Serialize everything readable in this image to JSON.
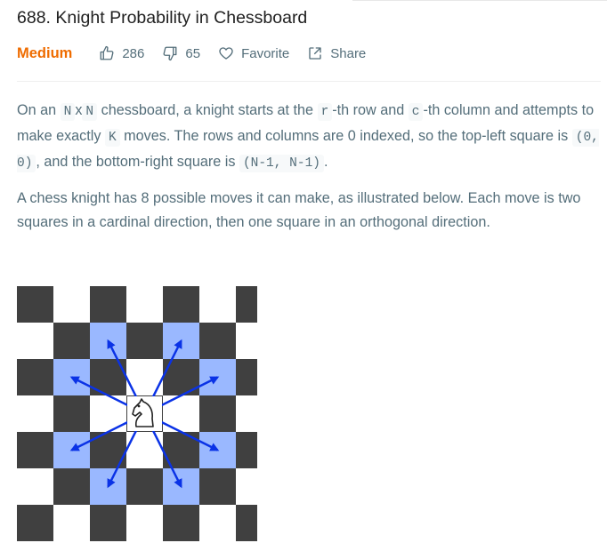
{
  "problem": {
    "title": "688. Knight Probability in Chessboard",
    "difficulty": "Medium",
    "likes": "286",
    "dislikes": "65",
    "favorite_label": "Favorite",
    "share_label": "Share"
  },
  "description": {
    "p1": {
      "t1": "On an ",
      "c1": "N",
      "t2": "x",
      "c2": "N",
      "t3": " chessboard, a knight starts at the ",
      "c3": "r",
      "t4": "-th row and ",
      "c4": "c",
      "t5": "-th column and attempts to make exactly ",
      "c5": "K",
      "t6": " moves. The rows and columns are 0 indexed, so the top-left square is ",
      "c6": "(0, 0)",
      "t7": ", and the bottom-right square is ",
      "c7": "(N-1, N-1)",
      "t8": "."
    },
    "p2": "A chess knight has 8 possible moves it can make, as illustrated below. Each move is two squares in a cardinal direction, then one square in an orthogonal direction."
  },
  "colors": {
    "difficulty": "#ef6c00",
    "dark_square": "#404040",
    "light_square": "#ffffff",
    "highlight_square": "#9ab8ff",
    "arrow": "#0a32e6"
  },
  "icons": {
    "like": "thumbs-up-icon",
    "dislike": "thumbs-down-icon",
    "favorite": "heart-icon",
    "share": "share-icon"
  }
}
